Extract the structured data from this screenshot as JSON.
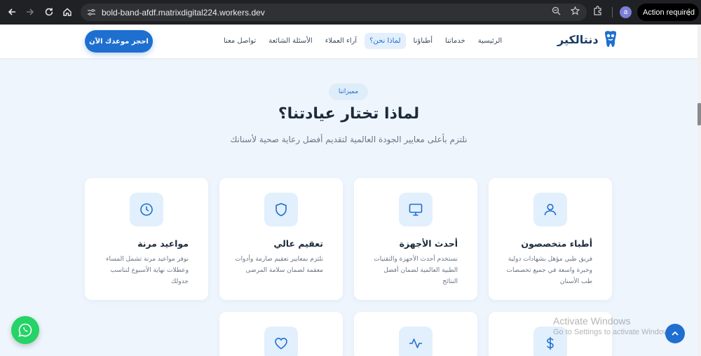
{
  "browser": {
    "url": "bold-band-afdf.matrixdigital224.workers.dev",
    "avatar_letter": "a",
    "action_label": "Action required"
  },
  "header": {
    "logo_text": "دنتالكير",
    "nav": [
      {
        "label": "الرئيسية",
        "active": false
      },
      {
        "label": "خدماتنا",
        "active": false
      },
      {
        "label": "أطباؤنا",
        "active": false
      },
      {
        "label": "لماذا نحن؟",
        "active": true
      },
      {
        "label": "آراء العملاء",
        "active": false
      },
      {
        "label": "الأسئلة الشائعة",
        "active": false
      },
      {
        "label": "تواصل معنا",
        "active": false
      }
    ],
    "cta_label": "احجز موعدك الآن"
  },
  "section": {
    "badge": "مميزاتنا",
    "title": "لماذا تختار عيادتنا؟",
    "subtitle": "نلتزم بأعلى معايير الجودة العالمية لتقديم أفضل رعاية صحية لأسنانك"
  },
  "features": [
    {
      "icon": "user-icon",
      "title": "أطباء متخصصون",
      "desc": "فريق طبي مؤهل بشهادات دولية وخبرة واسعة في جميع تخصصات طب الأسنان"
    },
    {
      "icon": "monitor-icon",
      "title": "أحدث الأجهزة",
      "desc": "نستخدم أحدث الأجهزة والتقنيات الطبية العالمية لضمان أفضل النتائج"
    },
    {
      "icon": "shield-icon",
      "title": "تعقيم عالي",
      "desc": "نلتزم بمعايير تعقيم صارمة وأدوات معقمة لضمان سلامة المرضى"
    },
    {
      "icon": "clock-icon",
      "title": "مواعيد مرنة",
      "desc": "نوفر مواعيد مرنة تشمل المساء وعطلات نهاية الأسبوع لتناسب جدولك"
    },
    {
      "icon": "dollar-icon",
      "title": "",
      "desc": ""
    },
    {
      "icon": "activity-icon",
      "title": "",
      "desc": ""
    },
    {
      "icon": "heart-icon",
      "title": "",
      "desc": ""
    }
  ],
  "watermark": {
    "line1": "Activate Windows",
    "line2": "Go to Settings to activate Windows."
  },
  "colors": {
    "primary": "#1e6fd0",
    "background": "#eef5fd",
    "whatsapp": "#25d366"
  }
}
